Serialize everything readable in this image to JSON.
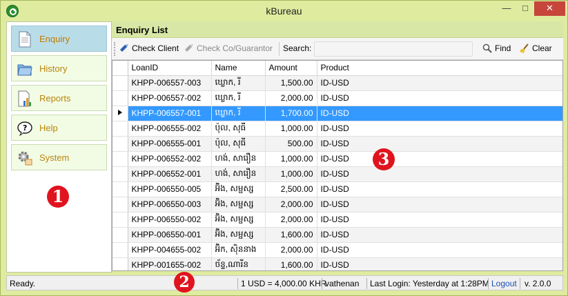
{
  "window": {
    "title": "kBureau"
  },
  "sidebar": {
    "items": [
      {
        "label": "Enquiry",
        "icon": "document-icon",
        "active": true
      },
      {
        "label": "History",
        "icon": "folder-icon",
        "active": false
      },
      {
        "label": "Reports",
        "icon": "report-chart-icon",
        "active": false
      },
      {
        "label": "Help",
        "icon": "help-bubble-icon",
        "active": false
      },
      {
        "label": "System",
        "icon": "gear-icon",
        "active": false
      }
    ]
  },
  "markers": [
    "1",
    "2",
    "3"
  ],
  "panel": {
    "title": "Enquiry List",
    "toolbar": {
      "check_client": "Check Client",
      "check_co": "Check Co/Guarantor",
      "search_label": "Search:",
      "search_value": "",
      "find": "Find",
      "clear": "Clear"
    },
    "columns": [
      "LoanID",
      "Name",
      "Amount",
      "Product"
    ],
    "rows": [
      [
        "KHPP-006557-003",
        "ឃ្លោក, រី",
        "1,500.00",
        "ID-USD"
      ],
      [
        "KHPP-006557-002",
        "ឃ្លោក, រី",
        "2,000.00",
        "ID-USD"
      ],
      [
        "KHPP-006557-001",
        "ឃ្លោក, រី",
        "1,700.00",
        "ID-USD"
      ],
      [
        "KHPP-006555-002",
        "ប៉ុល, សុធី",
        "1,000.00",
        "ID-USD"
      ],
      [
        "KHPP-006555-001",
        "ប៉ុល, សុធី",
        "500.00",
        "ID-USD"
      ],
      [
        "KHPP-006552-002",
        "ហង់, សារឿន",
        "1,000.00",
        "ID-USD"
      ],
      [
        "KHPP-006552-001",
        "ហង់, សារឿន",
        "1,000.00",
        "ID-USD"
      ],
      [
        "KHPP-006550-005",
        "អ៊ិង, សម្ផស្ស",
        "2,500.00",
        "ID-USD"
      ],
      [
        "KHPP-006550-003",
        "អ៊ិង, សម្ផស្ស",
        "2,000.00",
        "ID-USD"
      ],
      [
        "KHPP-006550-002",
        "អ៊ិង, សម្ផស្ស",
        "2,000.00",
        "ID-USD"
      ],
      [
        "KHPP-006550-001",
        "អ៊ិង, សម្ផស្ស",
        "1,600.00",
        "ID-USD"
      ],
      [
        "KHPP-004655-002",
        "អ៊ិក, ស៊ិននាង",
        "2,000.00",
        "ID-USD"
      ],
      [
        "KHPP-001655-002",
        "ច័ន្ទ,ណារីន",
        "1,600.00",
        "ID-USD"
      ]
    ],
    "selected_row": 2
  },
  "statusbar": {
    "ready": "Ready.",
    "rate": "1 USD = 4,000.00 KHR",
    "user": "vathenan",
    "last_login": "Last Login: Yesterday at 1:28PM",
    "logout": "Logout",
    "version": "v. 2.0.0"
  },
  "colors": {
    "selection": "#3399ff",
    "title_bar": "#dfeb9f",
    "marker": "#e0141e",
    "close": "#c7463b"
  }
}
